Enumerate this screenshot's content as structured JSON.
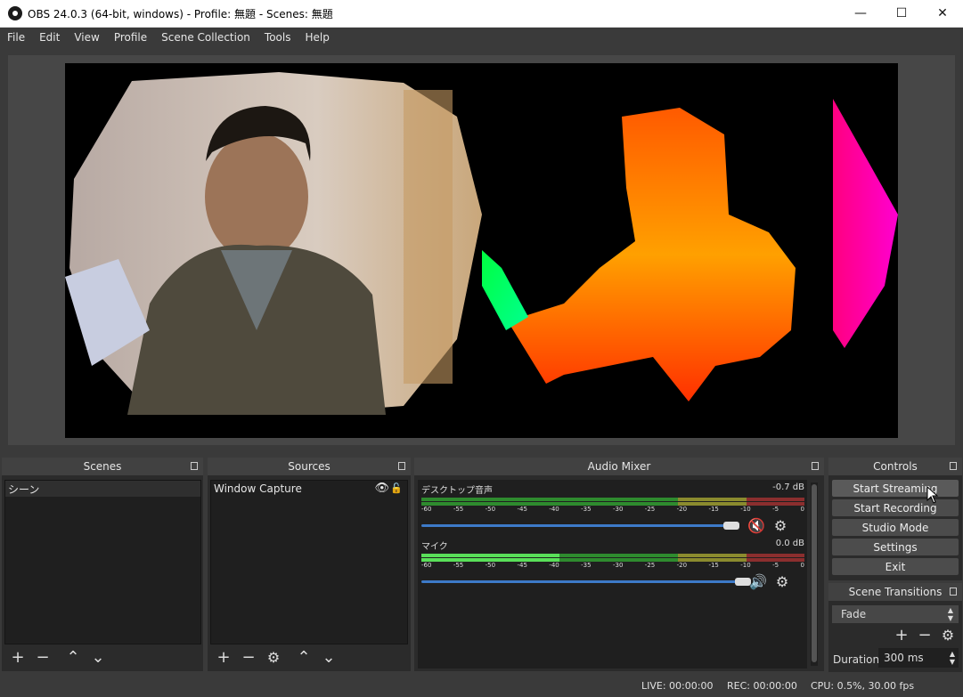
{
  "window": {
    "title": "OBS 24.0.3 (64-bit, windows) - Profile: 無題 - Scenes: 無題"
  },
  "menu": [
    "File",
    "Edit",
    "View",
    "Profile",
    "Scene Collection",
    "Tools",
    "Help"
  ],
  "docks": {
    "scenes": {
      "title": "Scenes",
      "items": [
        "シーン"
      ]
    },
    "sources": {
      "title": "Sources",
      "items": [
        "Window Capture"
      ]
    },
    "mixer": {
      "title": "Audio Mixer",
      "channels": [
        {
          "name": "デスクトップ音声",
          "db": "-0.7 dB",
          "muted": true,
          "level": 0.68
        },
        {
          "name": "マイク",
          "db": "0.0 dB",
          "muted": false,
          "level": 0.4
        }
      ],
      "ticks": [
        "-60",
        "-55",
        "-50",
        "-45",
        "-40",
        "-35",
        "-30",
        "-25",
        "-20",
        "-15",
        "-10",
        "-5",
        "0"
      ]
    },
    "controls": {
      "title": "Controls",
      "buttons": [
        "Start Streaming",
        "Start Recording",
        "Studio Mode",
        "Settings",
        "Exit"
      ]
    },
    "transitions": {
      "title": "Scene Transitions",
      "selected": "Fade",
      "duration_label": "Duration",
      "duration_value": "300 ms"
    }
  },
  "status": {
    "live": "LIVE: 00:00:00",
    "rec": "REC: 00:00:00",
    "cpu": "CPU: 0.5%, 30.00 fps"
  },
  "colors": {
    "accent": "#3d7ac8",
    "meter_green": "#2e8b2e",
    "meter_yellow": "#8b8b2e",
    "meter_red": "#8b2e2e",
    "mute_red": "#d02020"
  }
}
